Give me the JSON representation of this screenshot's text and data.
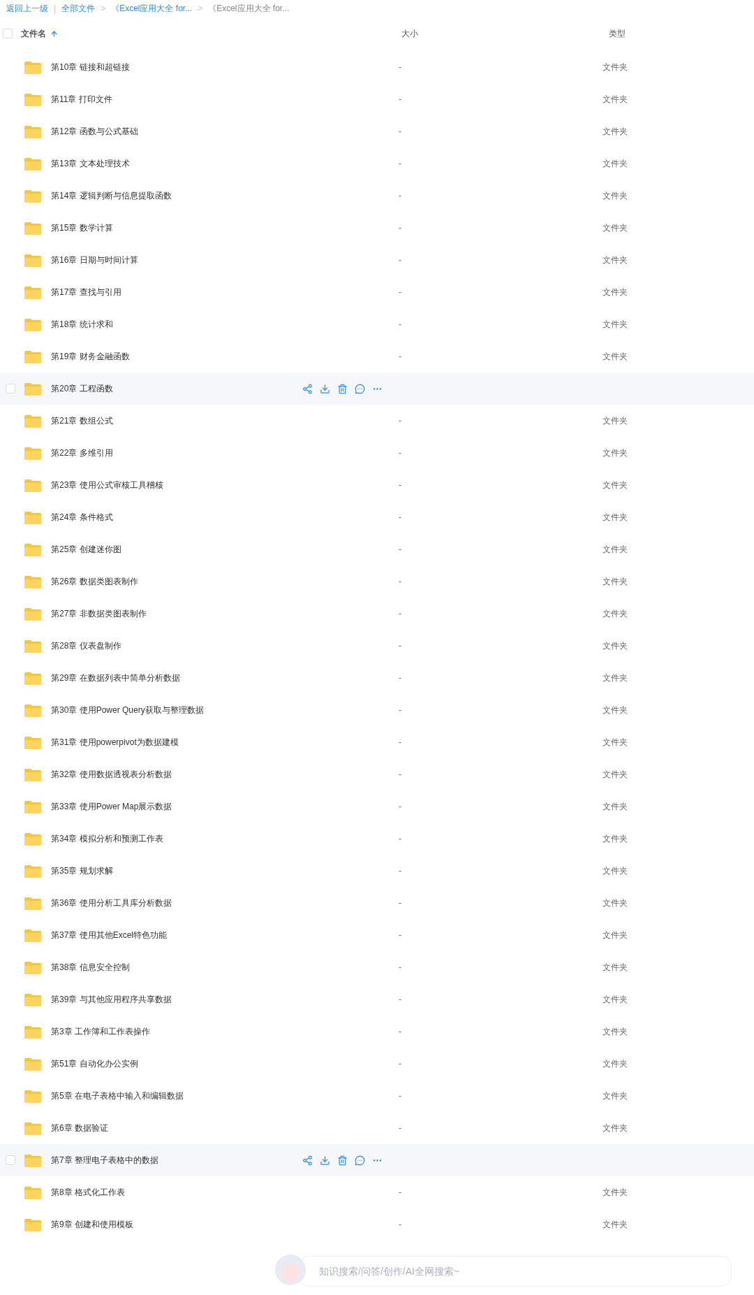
{
  "breadcrumb": [
    {
      "label": "返回上一级",
      "link": true
    },
    {
      "label": "全部文件",
      "link": true
    },
    {
      "label": "《Excel应用大全 for...",
      "link": true
    },
    {
      "label": "《Excel应用大全 for...",
      "link": false
    }
  ],
  "breadcrumb_separators": [
    "|",
    ">",
    ">"
  ],
  "select_all": {
    "checked": false
  },
  "table": {
    "columns": [
      {
        "label": "文件名",
        "sorted": true
      },
      {
        "label": "大小",
        "sorted": false
      },
      {
        "label": "类型",
        "sorted": false
      }
    ],
    "rows": [
      {
        "name": "第10章 链接和超链接",
        "size": "-",
        "type": "文件夹",
        "hovered": false
      },
      {
        "name": "第11章 打印文件",
        "size": "-",
        "type": "文件夹",
        "hovered": false
      },
      {
        "name": "第12章 函数与公式基础",
        "size": "-",
        "type": "文件夹",
        "hovered": false
      },
      {
        "name": "第13章 文本处理技术",
        "size": "-",
        "type": "文件夹",
        "hovered": false
      },
      {
        "name": "第14章 逻辑判断与信息提取函数",
        "size": "-",
        "type": "文件夹",
        "hovered": false
      },
      {
        "name": "第15章 数学计算",
        "size": "-",
        "type": "文件夹",
        "hovered": false
      },
      {
        "name": "第16章 日期与时间计算",
        "size": "-",
        "type": "文件夹",
        "hovered": false
      },
      {
        "name": "第17章 查找与引用",
        "size": "-",
        "type": "文件夹",
        "hovered": false
      },
      {
        "name": "第18章 统计求和",
        "size": "-",
        "type": "文件夹",
        "hovered": false
      },
      {
        "name": "第19章 财务金融函数",
        "size": "-",
        "type": "文件夹",
        "hovered": false
      },
      {
        "name": "第20章 工程函数",
        "hovered": true,
        "checked": false
      },
      {
        "name": "第21章 数组公式",
        "size": "-",
        "type": "文件夹",
        "hovered": false
      },
      {
        "name": "第22章 多维引用",
        "size": "-",
        "type": "文件夹",
        "hovered": false
      },
      {
        "name": "第23章 使用公式审核工具稽核",
        "size": "-",
        "type": "文件夹",
        "hovered": false
      },
      {
        "name": "第24章 条件格式",
        "size": "-",
        "type": "文件夹",
        "hovered": false
      },
      {
        "name": "第25章 创建迷你图",
        "size": "-",
        "type": "文件夹",
        "hovered": false
      },
      {
        "name": "第26章 数据类图表制作",
        "size": "-",
        "type": "文件夹",
        "hovered": false
      },
      {
        "name": "第27章 非数据类图表制作",
        "size": "-",
        "type": "文件夹",
        "hovered": false
      },
      {
        "name": "第28章 仪表盘制作",
        "size": "-",
        "type": "文件夹",
        "hovered": false
      },
      {
        "name": "第29章 在数据列表中简单分析数据",
        "size": "-",
        "type": "文件夹",
        "hovered": false
      },
      {
        "name": "第30章 使用Power Query获取与整理数据",
        "size": "-",
        "type": "文件夹",
        "hovered": false
      },
      {
        "name": "第31章 使用powerpivot为数据建模",
        "size": "-",
        "type": "文件夹",
        "hovered": false
      },
      {
        "name": "第32章 使用数据透视表分析数据",
        "size": "-",
        "type": "文件夹",
        "hovered": false
      },
      {
        "name": "第33章 使用Power Map展示数据",
        "size": "-",
        "type": "文件夹",
        "hovered": false
      },
      {
        "name": "第34章 模拟分析和预测工作表",
        "size": "-",
        "type": "文件夹",
        "hovered": false
      },
      {
        "name": "第35章 规划求解",
        "size": "-",
        "type": "文件夹",
        "hovered": false
      },
      {
        "name": "第36章 使用分析工具库分析数据",
        "size": "-",
        "type": "文件夹",
        "hovered": false
      },
      {
        "name": "第37章 使用其他Excel特色功能",
        "size": "-",
        "type": "文件夹",
        "hovered": false
      },
      {
        "name": "第38章 信息安全控制",
        "size": "-",
        "type": "文件夹",
        "hovered": false
      },
      {
        "name": "第39章 与其他应用程序共享数据",
        "size": "-",
        "type": "文件夹",
        "hovered": false
      },
      {
        "name": "第3章 工作簿和工作表操作",
        "size": "-",
        "type": "文件夹",
        "hovered": false
      },
      {
        "name": "第51章 自动化办公实例",
        "size": "-",
        "type": "文件夹",
        "hovered": false
      },
      {
        "name": "第5章 在电子表格中输入和编辑数据",
        "size": "-",
        "type": "文件夹",
        "hovered": false
      },
      {
        "name": "第6章 数据验证",
        "size": "-",
        "type": "文件夹",
        "hovered": false
      },
      {
        "name": "第7章 整理电子表格中的数据",
        "hovered": true,
        "checked": false
      },
      {
        "name": "第8章 格式化工作表",
        "size": "-",
        "type": "文件夹",
        "hovered": false
      },
      {
        "name": "第9章 创建和使用模板",
        "size": "-",
        "type": "文件夹",
        "hovered": false
      }
    ]
  },
  "ai_search": {
    "placeholder": "知识搜索/问答/创作/AI全网搜索~"
  }
}
